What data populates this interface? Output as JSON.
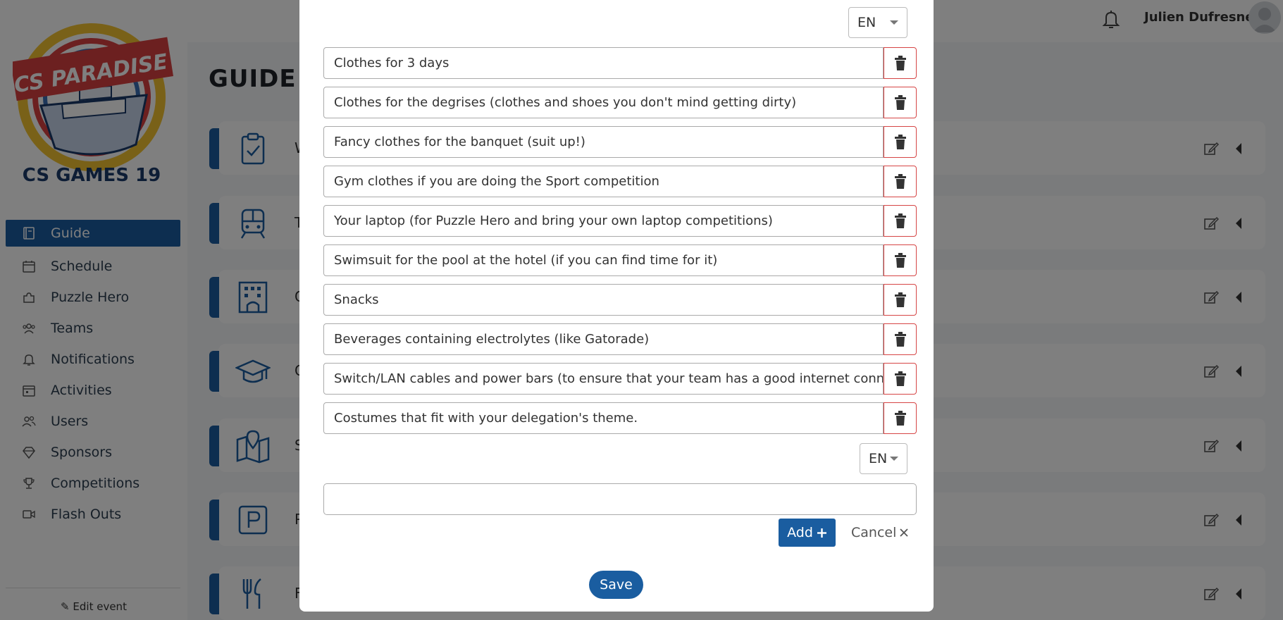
{
  "colors": {
    "accent": "#1a5da0",
    "danger": "#d64545",
    "logo_red": "#d94040",
    "logo_navy": "#1b3a6b",
    "logo_yellow": "#f2c230"
  },
  "sidebar": {
    "logo": {
      "line1": "CS PARADISE",
      "line2": "CS GAMES 19"
    },
    "items": [
      {
        "label": "Guide",
        "icon": "book-icon",
        "active": true
      },
      {
        "label": "Schedule",
        "icon": "calendar-icon",
        "active": false
      },
      {
        "label": "Puzzle Hero",
        "icon": "puzzle-icon",
        "active": false
      },
      {
        "label": "Teams",
        "icon": "team-icon",
        "active": false
      },
      {
        "label": "Notifications",
        "icon": "bell-icon",
        "active": false
      },
      {
        "label": "Activities",
        "icon": "calendar-check-icon",
        "active": false
      },
      {
        "label": "Users",
        "icon": "users-icon",
        "active": false
      },
      {
        "label": "Sponsors",
        "icon": "diamond-icon",
        "active": false
      },
      {
        "label": "Competitions",
        "icon": "trophy-icon",
        "active": false
      },
      {
        "label": "Flash Outs",
        "icon": "video-icon",
        "active": false
      }
    ],
    "edit_event": "Edit event"
  },
  "header": {
    "user_name": "Julien Dufresne"
  },
  "page": {
    "title": "GUIDE",
    "cards": [
      {
        "title": "W",
        "icon": "clipboard-check-icon"
      },
      {
        "title": "Tra",
        "icon": "train-icon"
      },
      {
        "title": "G",
        "icon": "hotel-icon"
      },
      {
        "title": "G",
        "icon": "graduation-cap-icon"
      },
      {
        "title": "S",
        "icon": "map-icon"
      },
      {
        "title": "P",
        "icon": "parking-icon"
      },
      {
        "title": "F",
        "icon": "utensils-icon"
      }
    ]
  },
  "modal": {
    "top_lang": "EN",
    "items": [
      "Clothes for 3 days",
      "Clothes for the degrises (clothes and shoes you don't mind getting dirty)",
      "Fancy clothes for the banquet (suit up!)",
      "Gym clothes if you are doing the Sport competition",
      "Your laptop (for Puzzle Hero and bring your own laptop competitions)",
      "Swimsuit for the pool at the hotel (if you can find time for it)",
      "Snacks",
      "Beverages containing electrolytes (like Gatorade)",
      "Switch/LAN cables and power bars (to ensure that your team has a good internet connec",
      "Costumes that fit with your delegation's theme."
    ],
    "new_item_lang": "EN",
    "new_item_value": "",
    "add_label": "Add",
    "cancel_label": "Cancel",
    "save_label": "Save"
  }
}
